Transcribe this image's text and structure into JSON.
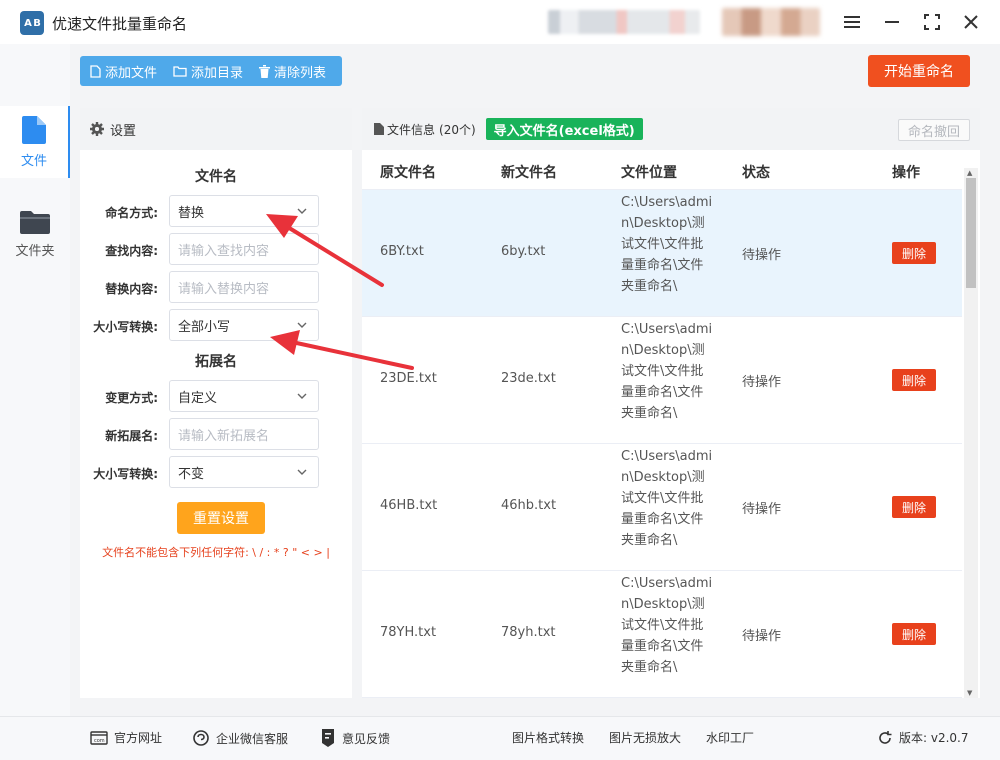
{
  "app": {
    "logo_text": "A B",
    "title": "优速文件批量重命名",
    "window_controls": [
      "menu-icon",
      "minimize-icon",
      "maximize-icon",
      "close-icon"
    ]
  },
  "sidebar": {
    "items": [
      {
        "label": "文件",
        "icon": "file-icon",
        "active": true
      },
      {
        "label": "文件夹",
        "icon": "folder-icon",
        "active": false
      }
    ]
  },
  "toolbar": {
    "add_file": "添加文件",
    "add_dir": "添加目录",
    "clear_list": "清除列表",
    "start": "开始重命名"
  },
  "settings": {
    "header": "设置",
    "filename_section": "文件名",
    "naming_mode_label": "命名方式:",
    "naming_mode_value": "替换",
    "find_label": "查找内容:",
    "find_placeholder": "请输入查找内容",
    "replace_label": "替换内容:",
    "replace_placeholder": "请输入替换内容",
    "case_label": "大小写转换:",
    "case_value": "全部小写",
    "ext_section": "拓展名",
    "change_mode_label": "变更方式:",
    "change_mode_value": "自定义",
    "new_ext_label": "新拓展名:",
    "new_ext_placeholder": "请输入新拓展名",
    "ext_case_label": "大小写转换:",
    "ext_case_value": "不变",
    "reset": "重置设置",
    "warning": "文件名不能包含下列任何字符: \\ / : * ? \" < > |"
  },
  "files": {
    "header": "文件信息",
    "count": "(20个)",
    "import_btn": "导入文件名(excel格式)",
    "undo_btn": "命名撤回",
    "columns": [
      "原文件名",
      "新文件名",
      "文件位置",
      "状态",
      "操作"
    ],
    "rows": [
      {
        "orig": "6BY.txt",
        "new": "6by.txt",
        "path": "C:\\Users\\admin\\Desktop\\测试文件\\文件批量重命名\\文件夹重命名\\",
        "status": "待操作",
        "action": "删除"
      },
      {
        "orig": "23DE.txt",
        "new": "23de.txt",
        "path": "C:\\Users\\admin\\Desktop\\测试文件\\文件批量重命名\\文件夹重命名\\",
        "status": "待操作",
        "action": "删除"
      },
      {
        "orig": "46HB.txt",
        "new": "46hb.txt",
        "path": "C:\\Users\\admin\\Desktop\\测试文件\\文件批量重命名\\文件夹重命名\\",
        "status": "待操作",
        "action": "删除"
      },
      {
        "orig": "78YH.txt",
        "new": "78yh.txt",
        "path": "C:\\Users\\admin\\Desktop\\测试文件\\文件批量重命名\\文件夹重命名\\",
        "status": "待操作",
        "action": "删除"
      }
    ]
  },
  "footer": {
    "website": "官方网址",
    "wechat": "企业微信客服",
    "feedback": "意见反馈",
    "img_convert": "图片格式转换",
    "img_enlarge": "图片无损放大",
    "watermark": "水印工厂",
    "version": "版本: v2.0.7"
  },
  "colors": {
    "accent_blue": "#2d8cf0",
    "toolbar_blue": "#4fa9ea",
    "start_orange": "#f0501f",
    "reset_orange": "#ffa41c",
    "import_green": "#19b35a",
    "delete_red": "#e8411c",
    "warning_red": "#e6421e"
  }
}
